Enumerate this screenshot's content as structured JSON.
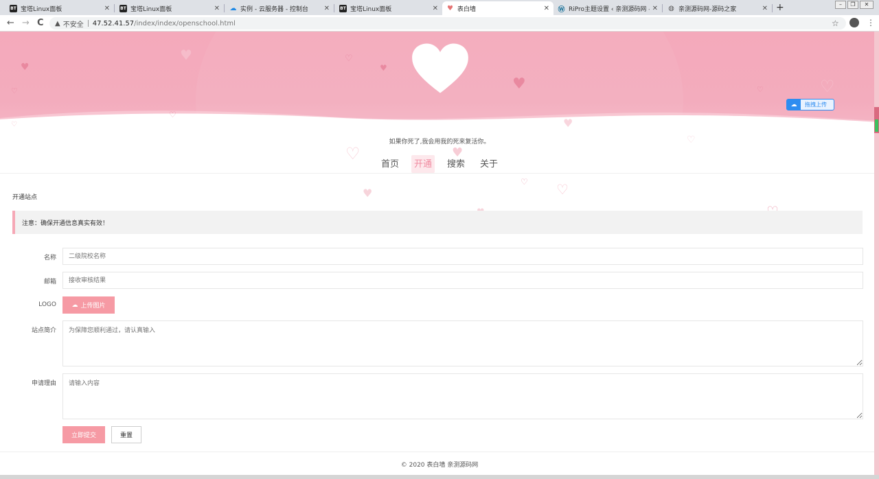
{
  "browser": {
    "tabs": [
      {
        "icon": "bt-icon",
        "title": "宝塔Linux面板",
        "active": false
      },
      {
        "icon": "bt-icon",
        "title": "宝塔Linux面板",
        "active": false
      },
      {
        "icon": "cloud-icon",
        "title": "实例 - 云服务器 - 控制台",
        "active": false
      },
      {
        "icon": "bt-icon",
        "title": "宝塔Linux面板",
        "active": false
      },
      {
        "icon": "heart-icon",
        "title": "表白墙",
        "active": true
      },
      {
        "icon": "wordpress-icon",
        "title": "RiPro主题设置 ‹ 亲测源码网 — W",
        "active": false
      },
      {
        "icon": "globe-icon",
        "title": "亲测源码网-源码之家",
        "active": false
      }
    ],
    "fav_text": "BT",
    "close_glyph": "✕",
    "new_tab_glyph": "+",
    "back_glyph": "←",
    "forward_glyph": "→",
    "reload_glyph": "C",
    "security_label": "不安全",
    "url_host": "47.52.41.57",
    "url_path": "/index/index/openschool.html",
    "star_glyph": "☆",
    "menu_glyph": "⋮"
  },
  "upload_widget": {
    "label": "拖拽上传"
  },
  "header": {
    "tagline": "如果你死了,我会用我的死来复活你。"
  },
  "nav": {
    "items": [
      "首页",
      "开通",
      "搜索",
      "关于"
    ],
    "active_index": 1
  },
  "content": {
    "section_title": "开通站点",
    "notice": "注意：确保开通信息真实有效！"
  },
  "form": {
    "name_label": "名称",
    "name_placeholder": "二级院校名称",
    "email_label": "邮箱",
    "email_placeholder": "接收审核结果",
    "logo_label": "LOGO",
    "upload_button": "上传图片",
    "intro_label": "站点简介",
    "intro_placeholder": "为保障您顺利通过，请认真输入",
    "reason_label": "申请理由",
    "reason_placeholder": "请输入内容",
    "submit_button": "立即提交",
    "reset_button": "重置"
  },
  "footer": {
    "text": "© 2020 表白墙  亲测源码网"
  },
  "colors": {
    "accent": "#f69aa4",
    "hero": "#f4a9bb",
    "link_blue": "#2e8df0"
  }
}
